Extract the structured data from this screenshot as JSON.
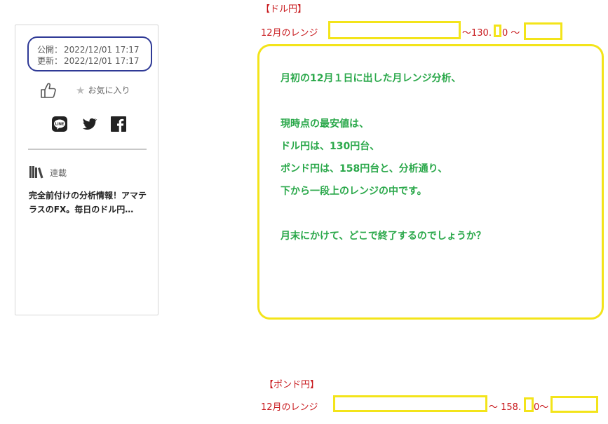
{
  "sidebar": {
    "published_label": "公開：",
    "published_value": "2022/12/01 17:17",
    "updated_label": "更新：",
    "updated_value": "2022/12/01 17:17",
    "favorite_label": "お気に入り",
    "share_icons": [
      "line-icon",
      "twitter-icon",
      "facebook-icon"
    ],
    "series_label": "連載",
    "series_title": "完全前付けの分析情報！アマテラスのFX。毎日のドル円…"
  },
  "usdjpy": {
    "heading": "【ドル円】",
    "range_prefix": "12月のレンジ",
    "range_mid": "～130.",
    "range_mid2": "0 ～"
  },
  "comment": {
    "lines": [
      "月初の12月１日に出した月レンジ分析、",
      "現時点の最安値は、",
      "ドル円は、130円台、",
      "ポンド円は、158円台と、分析通り、",
      "下から一段上のレンジの中です。",
      "月末にかけて、どこで終了するのでしょうか？"
    ]
  },
  "gbpjpy": {
    "heading": "【ポンド円】",
    "range_prefix": "12月のレンジ",
    "range_mid": "～ 158.",
    "range_mid2": "0～"
  },
  "colors": {
    "accent_red": "#c8191d",
    "highlight_yellow": "#f3e41a",
    "comment_green": "#2aa84a",
    "date_outline_blue": "#2f3a96"
  }
}
